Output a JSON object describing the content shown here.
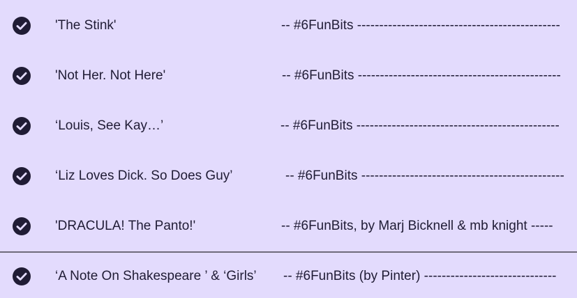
{
  "rows": [
    {
      "title": "'The Stink'",
      "note": "-- #6FunBits ----------------------------------------------"
    },
    {
      "title": "'Not Her. Not Here'",
      "note": "-- #6FunBits ----------------------------------------------"
    },
    {
      "title": "‘Louis, See Kay…’",
      "note": "-- #6FunBits ----------------------------------------------"
    },
    {
      "title": "‘Liz Loves Dick. So Does Guy’",
      "note": "-- #6FunBits ----------------------------------------------"
    },
    {
      "title": "'DRACULA! The Panto!'",
      "note": "--  #6FunBits, by Marj Bicknell & mb knight -----"
    },
    {
      "title": "‘A Note On Shakespeare ’ & ‘Girls’",
      "note": "-- #6FunBits (by Pinter) ------------------------------"
    }
  ],
  "colors": {
    "background": "#e3dbfd",
    "text": "#201c35",
    "check_fill": "#201c35",
    "check_mark": "#e3dbfd",
    "divider": "#6f6a7a"
  },
  "icons": {
    "row_status": "check-circle-icon"
  }
}
